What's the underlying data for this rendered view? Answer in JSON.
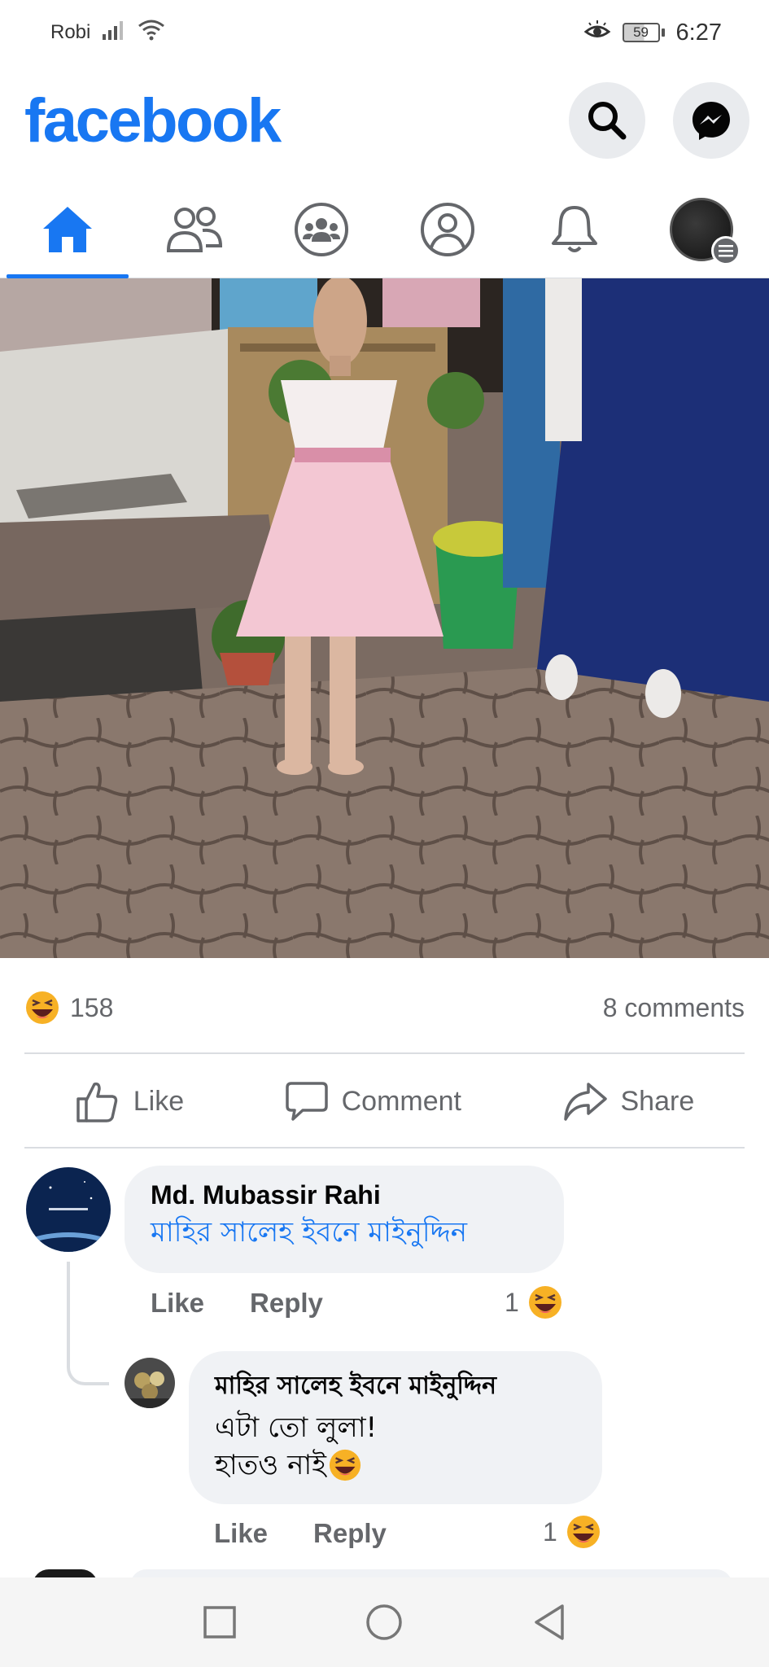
{
  "status_bar": {
    "carrier": "Robi",
    "battery": "59",
    "time": "6:27"
  },
  "header": {
    "logo": "facebook"
  },
  "icons": {
    "search": "search-icon",
    "messenger": "messenger-icon",
    "home": "home-icon",
    "friends": "friends-icon",
    "groups": "groups-icon",
    "profile": "profile-icon",
    "notifications": "bell-icon",
    "menu": "menu-icon"
  },
  "colors": {
    "brand": "#1877f2",
    "secondary_text": "#65676b",
    "bubble": "#f0f2f5",
    "haha": "#f7b125"
  },
  "post": {
    "reaction_count": "158",
    "comments_count": "8 comments",
    "actions": {
      "like": "Like",
      "comment": "Comment",
      "share": "Share"
    }
  },
  "comments": [
    {
      "author": "Md. Mubassir Rahi",
      "text": "মাহির সালেহ ইবনে মাইনুদ্দিন",
      "like": "Like",
      "reply": "Reply",
      "reactions": "1"
    },
    {
      "author": "মাহির সালেহ ইবনে মাইনুদ্দিন",
      "text_line1": "এটা তো লুলা!",
      "text_line2": "হাতও নাই",
      "like": "Like",
      "reply": "Reply",
      "reactions": "1"
    }
  ]
}
